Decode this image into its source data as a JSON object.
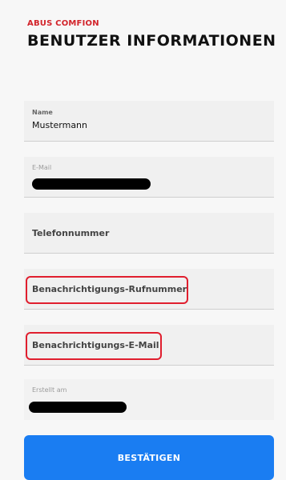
{
  "header": {
    "brand": "ABUS COMFION",
    "title": "BENUTZER INFORMATIONEN"
  },
  "fields": {
    "name": {
      "label": "Name",
      "value": "Mustermann"
    },
    "email": {
      "label": "E-Mail",
      "value": ""
    },
    "phone": {
      "placeholder": "Telefonnummer"
    },
    "notify_phone": {
      "placeholder": "Benachrichtigungs-Rufnummer"
    },
    "notify_email": {
      "placeholder": "Benachrichtigungs-E-Mail"
    },
    "created": {
      "label": "Erstellt am",
      "value": ""
    }
  },
  "button": {
    "label": "BESTÄTIGEN"
  },
  "colors": {
    "brand_red": "#d2232a",
    "button_blue": "#1a7df2",
    "highlight_red": "#e01e2e"
  }
}
